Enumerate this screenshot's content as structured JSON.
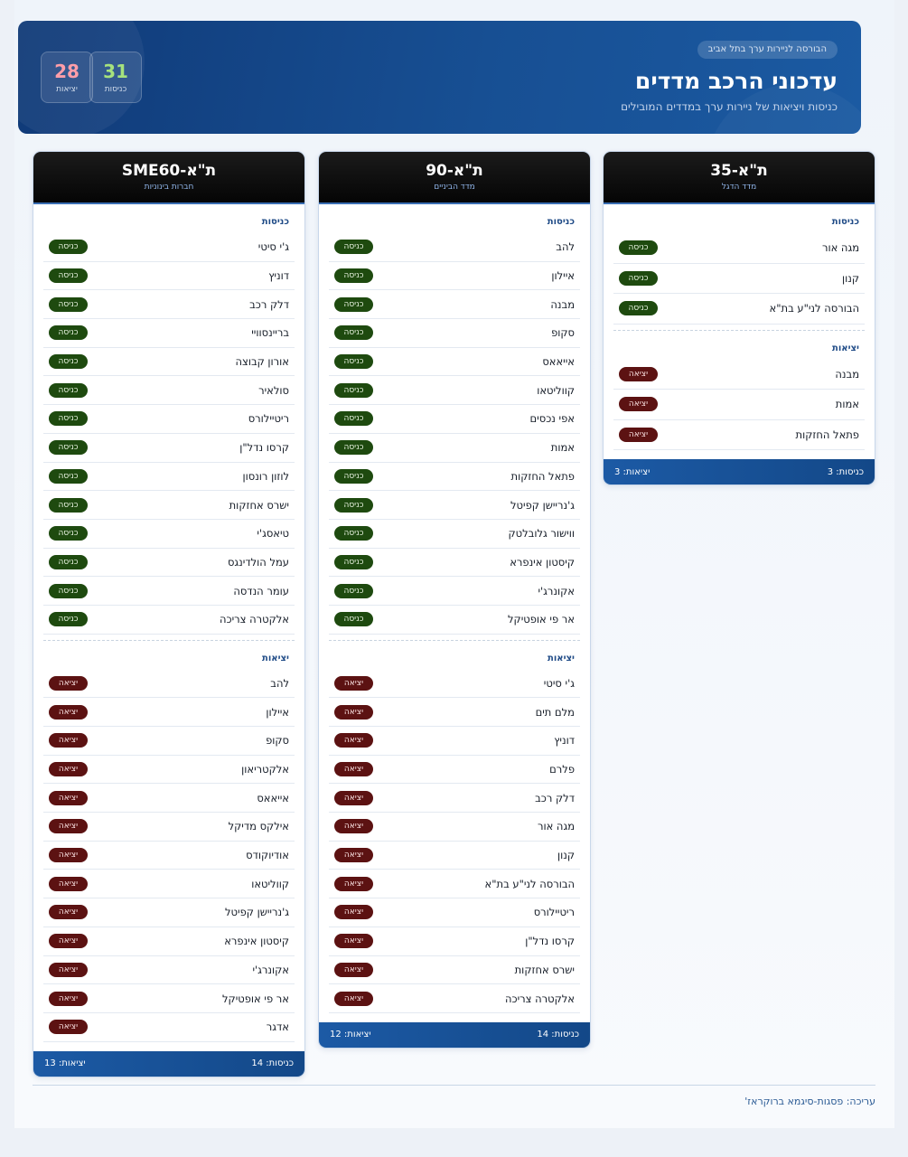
{
  "header": {
    "badge": "הבורסה לניירות ערך בתל אביב",
    "title": "עדכוני הרכב מדדים",
    "subtitle": "כניסות ויציאות של ניירות ערך במדדים המובילים",
    "stats": {
      "entries": {
        "value": "31",
        "label": "כניסות"
      },
      "exits": {
        "value": "28",
        "label": "יציאות"
      }
    }
  },
  "labels": {
    "entry_tag": "כניסה",
    "exit_tag": "יציאה"
  },
  "cards": [
    {
      "title": "ת\"א-35",
      "subtitle": "מדד הדגל",
      "entries_label": "כניסות",
      "exits_label": "יציאות",
      "entries": [
        "מגה אור",
        "קנון",
        "הבורסה לני\"ע בת\"א"
      ],
      "exits": [
        "מבנה",
        "אמות",
        "פתאל החזקות"
      ],
      "footer_entries": "כניסות: 3",
      "footer_exits": "יציאות: 3"
    },
    {
      "title": "ת\"א-90",
      "subtitle": "מדד הביניים",
      "entries_label": "כניסות",
      "exits_label": "יציאות",
      "entries": [
        "להב",
        "איילון",
        "מבנה",
        "סקופ",
        "אייאאס",
        "קווליטאו",
        "אפי נכסים",
        "אמות",
        "פתאל החזקות",
        "ג'נריישן קפיטל",
        "ווישור גלובלטק",
        "קיסטון אינפרא",
        "אקונרג'י",
        "אר פי אופטיקל"
      ],
      "exits": [
        "ג'י סיטי",
        "מלם תים",
        "דוניץ",
        "פלרם",
        "דלק רכב",
        "מגה אור",
        "קנון",
        "הבורסה לני\"ע בת\"א",
        "ריטיילורס",
        "קרסו נדל\"ן",
        "ישרס אחזקות",
        "אלקטרה צריכה"
      ],
      "footer_entries": "כניסות: 14",
      "footer_exits": "יציאות: 12"
    },
    {
      "title": "ת\"א-SME60",
      "subtitle": "חברות בינוניות",
      "entries_label": "כניסות",
      "exits_label": "יציאות",
      "entries": [
        "ג'י סיטי",
        "דוניץ",
        "דלק רכב",
        "בריינסוויי",
        "אורון קבוצה",
        "סולאיר",
        "ריטיילורס",
        "קרסו נדל\"ן",
        "לוזון רונסון",
        "ישרס אחזקות",
        "טיאסג'י",
        "עמל הולדינגס",
        "עומר הנדסה",
        "אלקטרה צריכה"
      ],
      "exits": [
        "להב",
        "איילון",
        "סקופ",
        "אלקטריאון",
        "אייאאס",
        "אילקס מדיקל",
        "אודיוקודס",
        "קווליטאו",
        "ג'נריישן קפיטל",
        "קיסטון אינפרא",
        "אקונרג'י",
        "אר פי אופטיקל",
        "אדגר"
      ],
      "footer_entries": "כניסות: 14",
      "footer_exits": "יציאות: 13"
    }
  ],
  "footer": {
    "credit": "עריכה: פסגות-סיגמא ברוקראז'"
  }
}
